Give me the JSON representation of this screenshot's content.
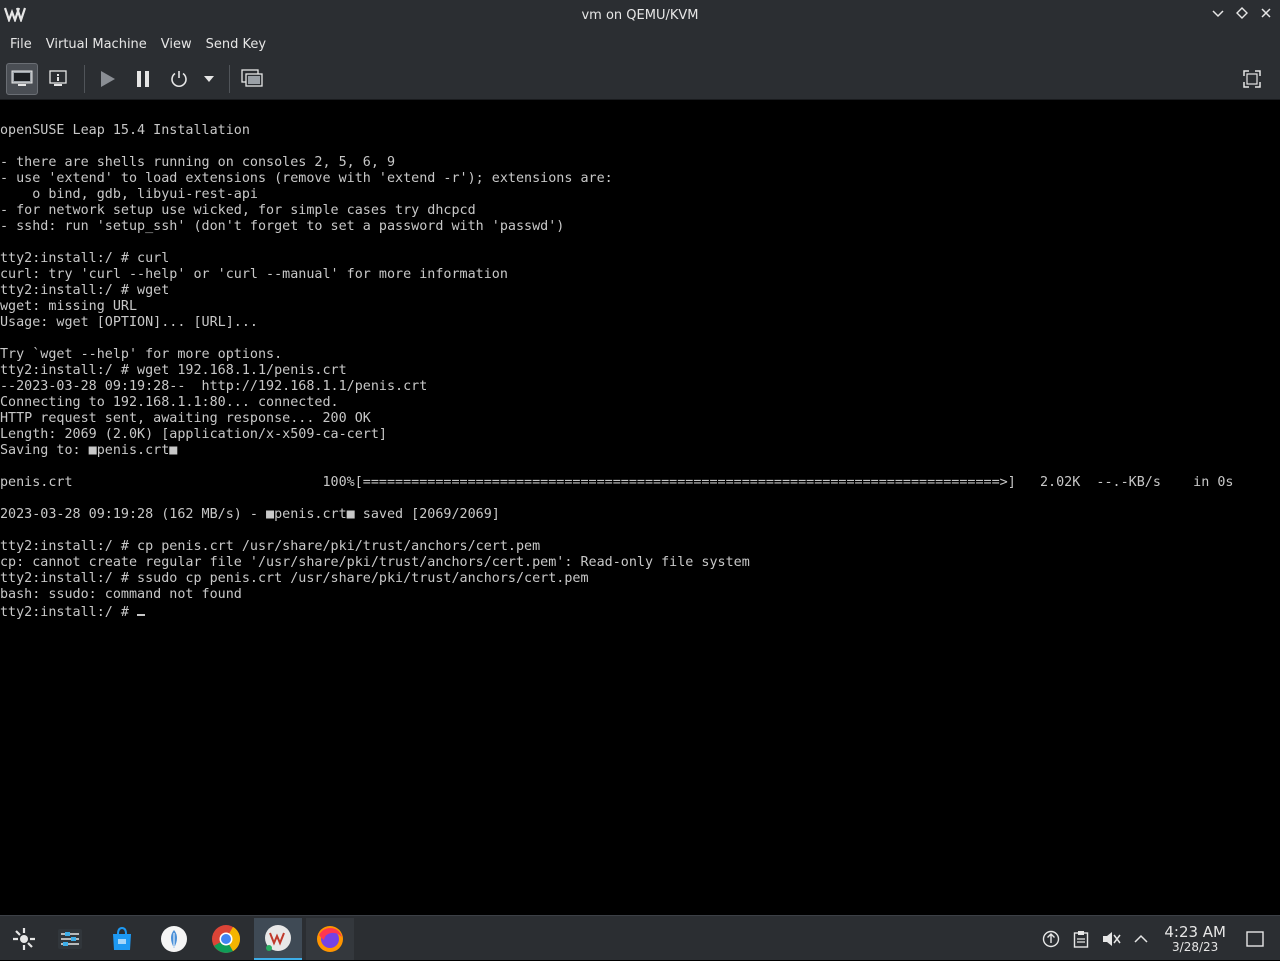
{
  "window": {
    "title": "vm on QEMU/KVM",
    "logo_text": "VM"
  },
  "menu": {
    "items": [
      "File",
      "Virtual Machine",
      "View",
      "Send Key"
    ]
  },
  "toolbar": {
    "buttons": [
      {
        "name": "console-view-button",
        "icon": "monitor-icon"
      },
      {
        "name": "details-view-button",
        "icon": "info-icon"
      },
      {
        "name": "run-button",
        "icon": "play-icon"
      },
      {
        "name": "pause-button",
        "icon": "pause-icon"
      },
      {
        "name": "shutdown-button",
        "icon": "power-icon"
      },
      {
        "name": "shutdown-menu-button",
        "icon": "chevron-down-icon"
      },
      {
        "name": "snapshots-button",
        "icon": "screens-icon"
      },
      {
        "name": "fullscreen-button",
        "icon": "fullscreen-icon"
      }
    ]
  },
  "console": {
    "lines": [
      "openSUSE Leap 15.4 Installation",
      "",
      "- there are shells running on consoles 2, 5, 6, 9",
      "- use 'extend' to load extensions (remove with 'extend -r'); extensions are:",
      "    o bind, gdb, libyui-rest-api",
      "- for network setup use wicked, for simple cases try dhcpcd",
      "- sshd: run 'setup_ssh' (don't forget to set a password with 'passwd')",
      "",
      "tty2:install:/ # curl",
      "curl: try 'curl --help' or 'curl --manual' for more information",
      "tty2:install:/ # wget",
      "wget: missing URL",
      "Usage: wget [OPTION]... [URL]...",
      "",
      "Try `wget --help' for more options.",
      "tty2:install:/ # wget 192.168.1.1/penis.crt",
      "--2023-03-28 09:19:28--  http://192.168.1.1/penis.crt",
      "Connecting to 192.168.1.1:80... connected.",
      "HTTP request sent, awaiting response... 200 OK",
      "Length: 2069 (2.0K) [application/x-x509-ca-cert]",
      "Saving to: ■penis.crt■",
      "",
      "penis.crt                               100%[===============================================================================>]   2.02K  --.-KB/s    in 0s",
      "",
      "2023-03-28 09:19:28 (162 MB/s) - ■penis.crt■ saved [2069/2069]",
      "",
      "tty2:install:/ # cp penis.crt /usr/share/pki/trust/anchors/cert.pem",
      "cp: cannot create regular file '/usr/share/pki/trust/anchors/cert.pem': Read-only file system",
      "tty2:install:/ # ssudo cp penis.crt /usr/share/pki/trust/anchors/cert.pem",
      "bash: ssudo: command not found"
    ],
    "prompt": "tty2:install:/ # "
  },
  "taskbar": {
    "items": [
      {
        "name": "app-launcher",
        "icon": "launcher-icon"
      },
      {
        "name": "task-manager",
        "icon": "sliders-icon"
      },
      {
        "name": "discover-store",
        "icon": "bag-icon"
      },
      {
        "name": "app-circle",
        "icon": "leaf-icon"
      },
      {
        "name": "chrome",
        "icon": "chrome-icon"
      },
      {
        "name": "virt-manager",
        "icon": "virt-manager-icon"
      },
      {
        "name": "firefox",
        "icon": "firefox-icon"
      }
    ],
    "clock_time": "4:23 AM",
    "clock_date": "3/28/23"
  },
  "colors": {
    "chrome_bg": "#2b2e32",
    "console_text": "#c8c8c8",
    "accent": "#3daee9"
  }
}
